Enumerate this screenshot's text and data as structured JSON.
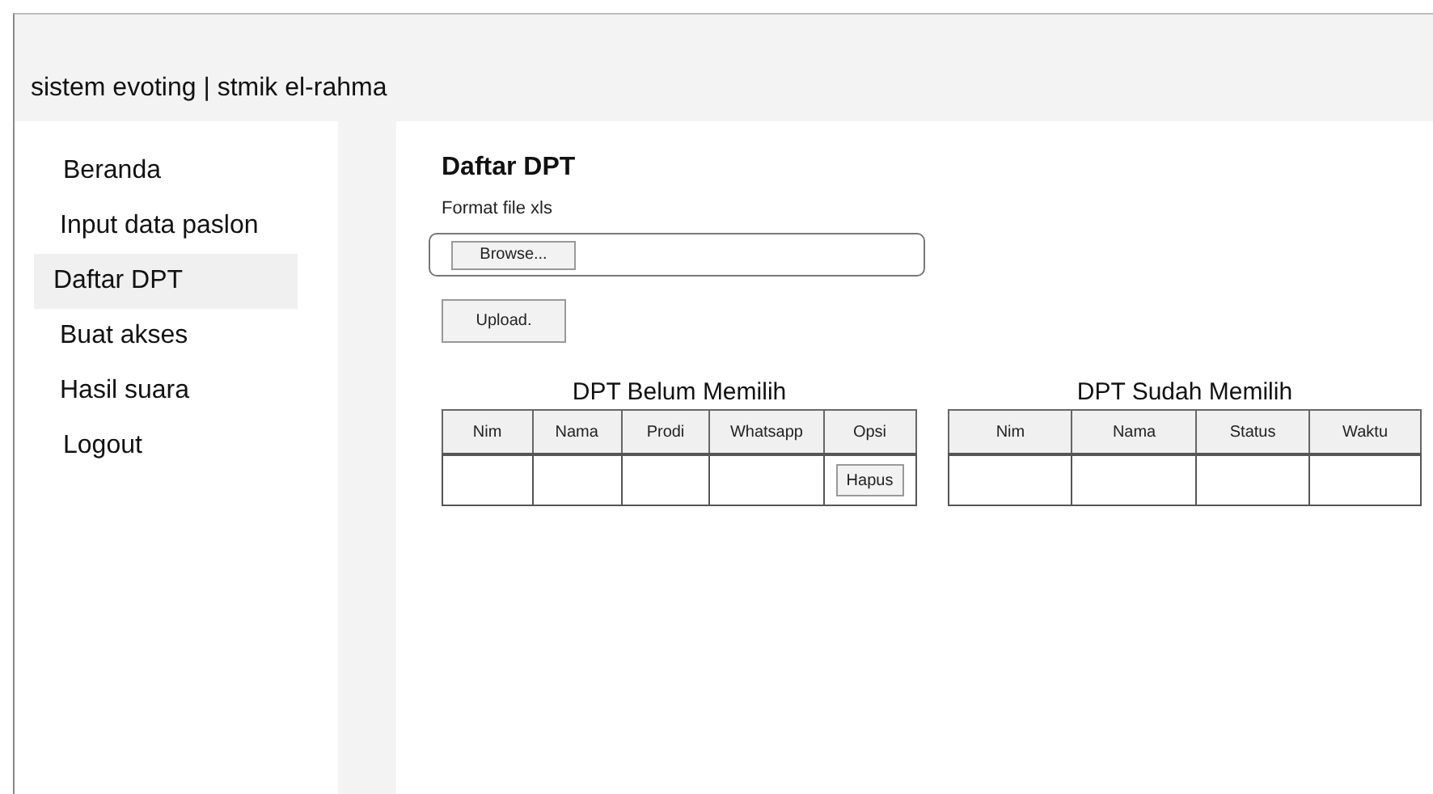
{
  "header": {
    "title": "sistem evoting | stmik el-rahma"
  },
  "sidebar": {
    "items": [
      {
        "label": "Beranda",
        "selected": false
      },
      {
        "label": "Input data paslon",
        "selected": false
      },
      {
        "label": "Daftar DPT",
        "selected": true
      },
      {
        "label": "Buat akses",
        "selected": false
      },
      {
        "label": "Hasil suara",
        "selected": false
      },
      {
        "label": "Logout",
        "selected": false
      }
    ]
  },
  "main": {
    "title": "Daftar DPT",
    "file_label": "Format file xls",
    "browse_button": "Browse...",
    "upload_button": "Upload.",
    "tables": [
      {
        "title": "DPT Belum Memilih",
        "columns": [
          "Nim",
          "Nama",
          "Prodi",
          "Whatsapp",
          "Opsi"
        ],
        "rows": [
          [
            "",
            "",
            "",
            "",
            {
              "kind": "button",
              "label": "Hapus"
            }
          ]
        ]
      },
      {
        "title": "DPT Sudah Memilih",
        "columns": [
          "Nim",
          "Nama",
          "Status",
          "Waktu"
        ],
        "rows": [
          [
            "",
            "",
            "",
            ""
          ]
        ]
      }
    ]
  }
}
